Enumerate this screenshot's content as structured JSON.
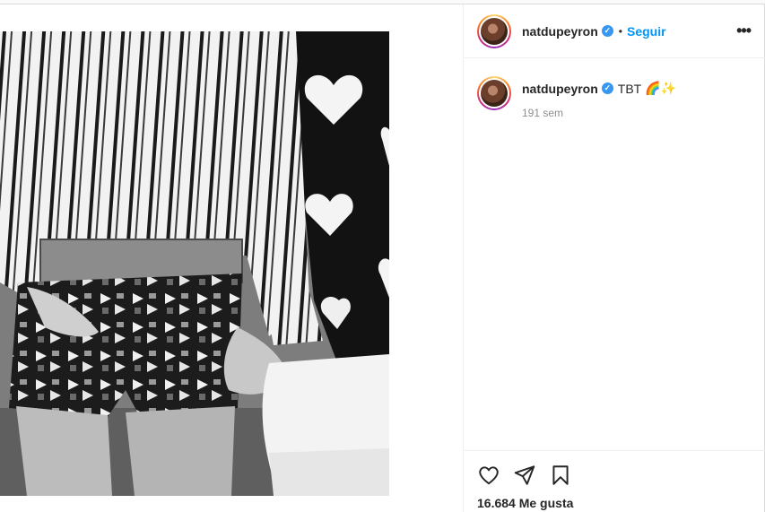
{
  "post": {
    "image_alt": "Black and white photo of two people holding hands",
    "header": {
      "username": "natdupeyron",
      "verified_icon": "verified-badge-icon",
      "separator": "•",
      "follow_label": "Seguir",
      "more_icon": "more-options-icon",
      "more_glyph": "•••"
    },
    "caption": {
      "username": "natdupeyron",
      "text": "TBT",
      "emojis": "🌈✨",
      "time_ago": "191 sem"
    },
    "actions": {
      "like_icon": "heart-icon",
      "share_icon": "paper-plane-icon",
      "save_icon": "bookmark-icon",
      "likes_text": "16.684 Me gusta"
    },
    "colors": {
      "accent": "#0095f6",
      "verified": "#3897f0",
      "text": "#262626",
      "muted": "#8e8e8e"
    }
  }
}
